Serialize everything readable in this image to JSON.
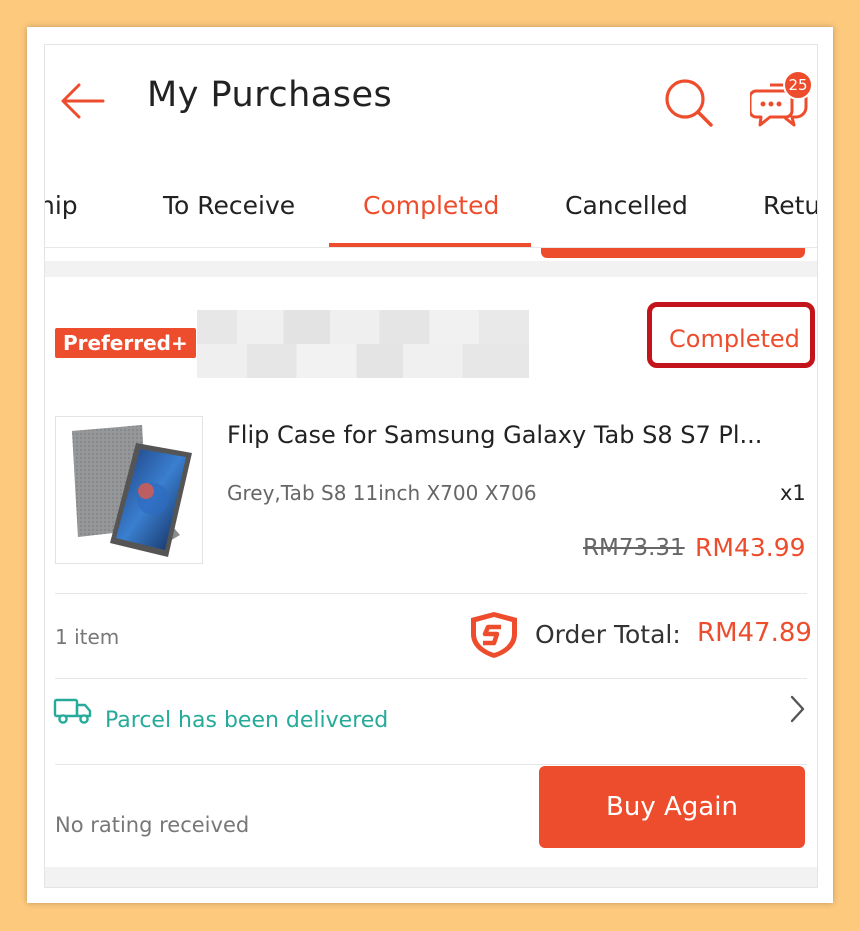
{
  "header": {
    "title": "My Purchases",
    "chat_badge": "25"
  },
  "tabs": [
    {
      "label": "hip"
    },
    {
      "label": "To Receive"
    },
    {
      "label": "Completed"
    },
    {
      "label": "Cancelled"
    },
    {
      "label": "Retu"
    }
  ],
  "active_tab": "Completed",
  "order": {
    "shop_badge": "Preferred+",
    "status": "Completed",
    "product_name": "Flip Case for Samsung Galaxy Tab S8 S7 Pl...",
    "variant": "Grey,Tab S8 11inch X700 X706",
    "quantity": "x1",
    "original_price": "RM73.31",
    "price": "RM43.99",
    "item_count": "1 item",
    "order_total_label": "Order Total:",
    "order_total": "RM47.89",
    "delivery_status": "Parcel has been delivered",
    "rating_status": "No rating received",
    "buy_again_label": "Buy Again"
  },
  "colors": {
    "accent": "#ee4d2d",
    "delivery": "#26aa99",
    "highlight_box": "#c4141b",
    "background_border": "#fdc97d"
  },
  "icons": {
    "back": "arrow-left-icon",
    "search": "search-icon",
    "chat": "chat-bubbles-icon",
    "shield": "shopee-guarantee-shield-icon",
    "truck": "truck-icon",
    "chevron": "chevron-right-icon"
  }
}
